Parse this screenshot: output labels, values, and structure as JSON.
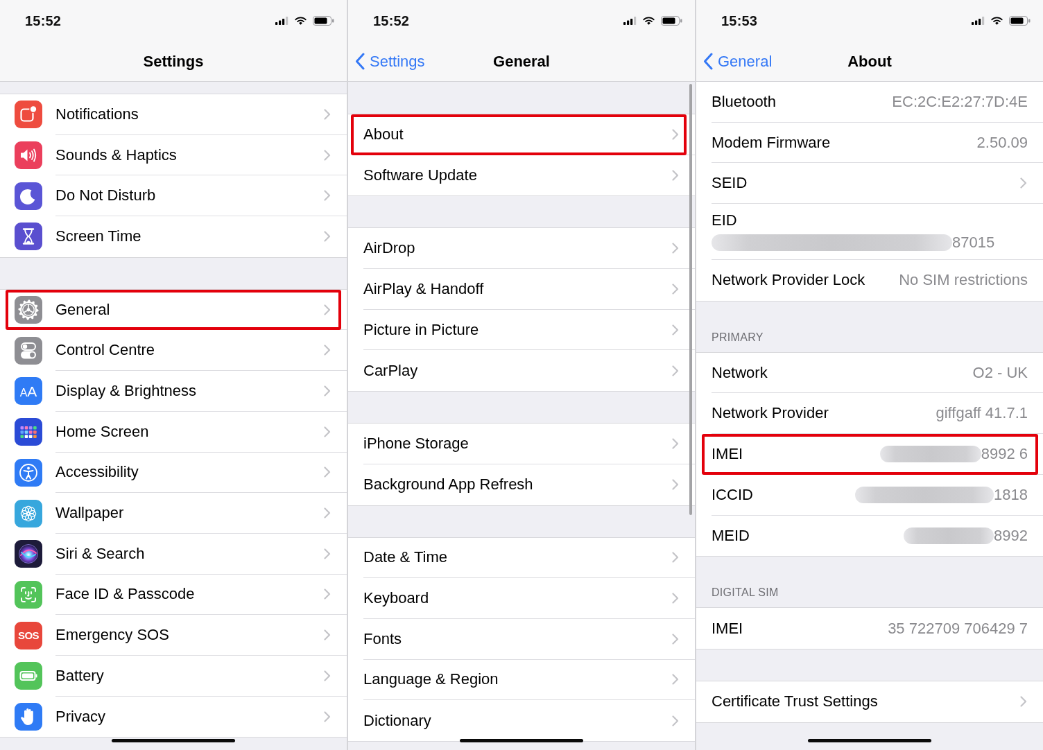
{
  "screens": [
    {
      "status_bar": {
        "time": "15:52"
      },
      "nav_bar": {
        "title": "Settings"
      },
      "scroll_indicator": false,
      "groups": [
        {
          "items": [
            {
              "kind": "icon_link",
              "label": "Notifications",
              "color": "#ee4c3f",
              "highlighted": false
            },
            {
              "kind": "icon_link",
              "label": "Sounds & Haptics",
              "color": "#eb3f5c",
              "highlighted": false
            },
            {
              "kind": "icon_link",
              "label": "Do Not Disturb",
              "color": "#5a55d6",
              "highlighted": false
            },
            {
              "kind": "icon_link",
              "label": "Screen Time",
              "color": "#5a4fcf",
              "highlighted": false
            }
          ]
        },
        {
          "items": [
            {
              "kind": "icon_link",
              "label": "General",
              "color": "#8e8e93",
              "highlighted": true
            },
            {
              "kind": "icon_link",
              "label": "Control Centre",
              "color": "#8e8e93",
              "highlighted": false
            },
            {
              "kind": "icon_link",
              "label": "Display & Brightness",
              "color": "#2f7bf5",
              "icon_text": "AA",
              "highlighted": false
            },
            {
              "kind": "icon_link",
              "label": "Home Screen",
              "color": "#2b4bd6",
              "highlighted": false
            },
            {
              "kind": "icon_link",
              "label": "Accessibility",
              "color": "#2f7bf5",
              "highlighted": false
            },
            {
              "kind": "icon_link",
              "label": "Wallpaper",
              "color": "#37a7dd",
              "highlighted": false
            },
            {
              "kind": "icon_link",
              "label": "Siri & Search",
              "color": "#1d1b3a",
              "highlighted": false
            },
            {
              "kind": "icon_link",
              "label": "Face ID & Passcode",
              "color": "#53c45a",
              "highlighted": false
            },
            {
              "kind": "icon_link",
              "label": "Emergency SOS",
              "color": "#e8473b",
              "icon_text": "SOS",
              "highlighted": false
            },
            {
              "kind": "icon_link",
              "label": "Battery",
              "color": "#53c45a",
              "highlighted": false
            },
            {
              "kind": "icon_link",
              "label": "Privacy",
              "color": "#2f7bf5",
              "highlighted": false
            }
          ]
        }
      ]
    },
    {
      "status_bar": {
        "time": "15:52"
      },
      "nav_bar": {
        "back": "Settings",
        "title": "General"
      },
      "scroll_indicator": true,
      "groups": [
        {
          "items": [
            {
              "kind": "link",
              "label": "About",
              "highlighted": true
            },
            {
              "kind": "link",
              "label": "Software Update",
              "highlighted": false
            }
          ]
        },
        {
          "items": [
            {
              "kind": "link",
              "label": "AirDrop",
              "highlighted": false
            },
            {
              "kind": "link",
              "label": "AirPlay & Handoff",
              "highlighted": false
            },
            {
              "kind": "link",
              "label": "Picture in Picture",
              "highlighted": false
            },
            {
              "kind": "link",
              "label": "CarPlay",
              "highlighted": false
            }
          ]
        },
        {
          "items": [
            {
              "kind": "link",
              "label": "iPhone Storage",
              "highlighted": false
            },
            {
              "kind": "link",
              "label": "Background App Refresh",
              "highlighted": false
            }
          ]
        },
        {
          "items": [
            {
              "kind": "link",
              "label": "Date & Time",
              "highlighted": false
            },
            {
              "kind": "link",
              "label": "Keyboard",
              "highlighted": false
            },
            {
              "kind": "link",
              "label": "Fonts",
              "highlighted": false
            },
            {
              "kind": "link",
              "label": "Language & Region",
              "highlighted": false
            },
            {
              "kind": "link",
              "label": "Dictionary",
              "highlighted": false
            }
          ]
        }
      ]
    },
    {
      "status_bar": {
        "time": "15:53"
      },
      "nav_bar": {
        "back": "General",
        "title": "About"
      },
      "scroll_indicator": false,
      "groups": [
        {
          "items": [
            {
              "kind": "info",
              "label": "Bluetooth",
              "value": "EC:2C:E2:27:7D:4E",
              "redacted": false,
              "highlighted": false
            },
            {
              "kind": "info",
              "label": "Modem Firmware",
              "value": "2.50.09",
              "redacted": false,
              "highlighted": false
            },
            {
              "kind": "link",
              "label": "SEID",
              "highlighted": false
            },
            {
              "kind": "info_stacked",
              "label": "EID",
              "value": "87015",
              "redacted": true,
              "highlighted": false
            },
            {
              "kind": "info",
              "label": "Network Provider Lock",
              "value": "No SIM restrictions",
              "redacted": false,
              "highlighted": false
            }
          ]
        },
        {
          "header": "PRIMARY",
          "items": [
            {
              "kind": "info",
              "label": "Network",
              "value": "O2 - UK",
              "redacted": false,
              "highlighted": false
            },
            {
              "kind": "info",
              "label": "Network Provider",
              "value": "giffgaff 41.7.1",
              "redacted": false,
              "highlighted": false
            },
            {
              "kind": "info",
              "label": "IMEI",
              "value": "8992 6",
              "redacted": true,
              "highlighted": true
            },
            {
              "kind": "info",
              "label": "ICCID",
              "value": "1818",
              "redacted": true,
              "highlighted": false
            },
            {
              "kind": "info",
              "label": "MEID",
              "value": "8992",
              "redacted": true,
              "highlighted": false
            }
          ]
        },
        {
          "header": "DIGITAL SIM",
          "items": [
            {
              "kind": "info",
              "label": "IMEI",
              "value": "35 722709 706429 7",
              "redacted": false,
              "highlighted": false
            }
          ]
        },
        {
          "items": [
            {
              "kind": "link",
              "label": "Certificate Trust Settings",
              "highlighted": false
            }
          ]
        }
      ]
    }
  ]
}
